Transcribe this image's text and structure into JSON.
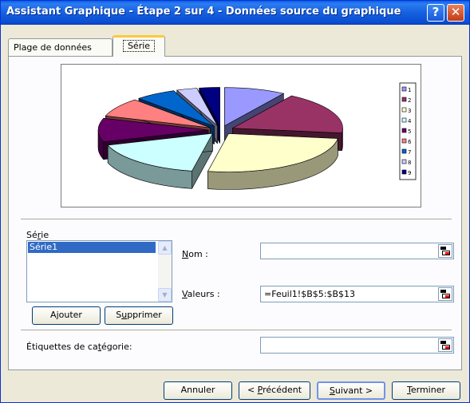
{
  "window": {
    "title": "Assistant Graphique - Étape 2 sur 4 - Données source du graphique",
    "help_label": "?",
    "close_label": "✕"
  },
  "tabs": [
    {
      "label": "Plage de données",
      "active": false
    },
    {
      "label": "Série",
      "active": true
    }
  ],
  "chart_data": {
    "type": "pie",
    "categories": [
      "1",
      "2",
      "3",
      "4",
      "5",
      "6",
      "7",
      "8",
      "9"
    ],
    "values": [
      9,
      18,
      26,
      17,
      10,
      8,
      6,
      3,
      3
    ],
    "colors": [
      "#9999ff",
      "#993366",
      "#ffffcc",
      "#ccffff",
      "#660066",
      "#ff8080",
      "#0066cc",
      "#ccccff",
      "#000080"
    ],
    "legend_position": "right"
  },
  "series": {
    "label_prefix": "Sé",
    "label_mnemonic": "r",
    "label_suffix": "ie",
    "items": [
      "Série1"
    ],
    "add_mnemonic": "j",
    "add_prefix": "A",
    "add_suffix": "outer",
    "remove_prefix": "S",
    "remove_mnemonic": "u",
    "remove_suffix": "pprimer"
  },
  "name_field": {
    "label_mnemonic": "N",
    "label_suffix": "om :",
    "value": ""
  },
  "values_field": {
    "label_mnemonic": "V",
    "label_suffix": "aleurs :",
    "value": "=Feuil1!$B$5:$B$13"
  },
  "category_field": {
    "label_prefix": "Étiquettes de ca",
    "label_mnemonic": "t",
    "label_suffix": "égorie:",
    "value": ""
  },
  "footer": {
    "cancel": "Annuler",
    "prev_prefix": "< ",
    "prev_mnemonic": "P",
    "prev_suffix": "récédent",
    "next_mnemonic": "S",
    "next_suffix": "uivant >",
    "finish_mnemonic": "T",
    "finish_suffix": "erminer"
  }
}
